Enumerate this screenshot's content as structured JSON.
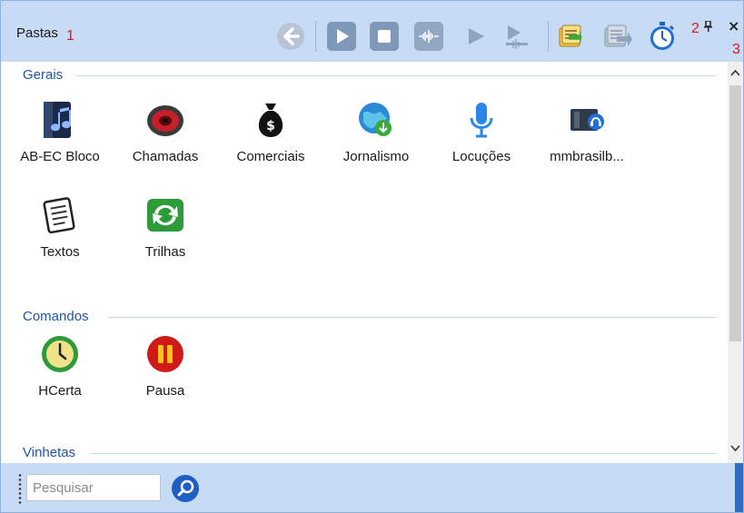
{
  "header": {
    "title": "Pastas",
    "marker_1": "1",
    "marker_2": "2",
    "marker_3": "3",
    "pin_glyph": "📌",
    "close_glyph": "×",
    "toolbar_icons": [
      "back-arrow-icon",
      "play-icon",
      "stop-icon",
      "waveform-icon",
      "play-small-icon",
      "cue-icon",
      "export-playlist-icon",
      "import-playlist-icon",
      "stopwatch-icon"
    ]
  },
  "groups": [
    {
      "label": "Gerais",
      "items": [
        {
          "label": "AB-EC Bloco",
          "icon": "music-note-icon"
        },
        {
          "label": "Chamadas",
          "icon": "speaker-icon"
        },
        {
          "label": "Comerciais",
          "icon": "money-bag-icon"
        },
        {
          "label": "Jornalismo",
          "icon": "globe-download-icon"
        },
        {
          "label": "Locuções",
          "icon": "microphone-icon"
        },
        {
          "label": "mmbrasilb...",
          "icon": "media-folder-icon"
        },
        {
          "label": "Textos",
          "icon": "notepad-icon"
        },
        {
          "label": "Trilhas",
          "icon": "refresh-arrows-icon"
        }
      ]
    },
    {
      "label": "Comandos",
      "items": [
        {
          "label": "HCerta",
          "icon": "clock-icon"
        },
        {
          "label": "Pausa",
          "icon": "pause-icon"
        }
      ]
    },
    {
      "label": "Vinhetas",
      "items": []
    }
  ],
  "search": {
    "placeholder": "Pesquisar",
    "value": ""
  },
  "scroll": {
    "up_glyph": "^",
    "down_glyph": "v"
  },
  "colors": {
    "header_bg": "#c8dbf5",
    "group_heading": "#1f55a8",
    "marker_red": "#e0141e"
  }
}
